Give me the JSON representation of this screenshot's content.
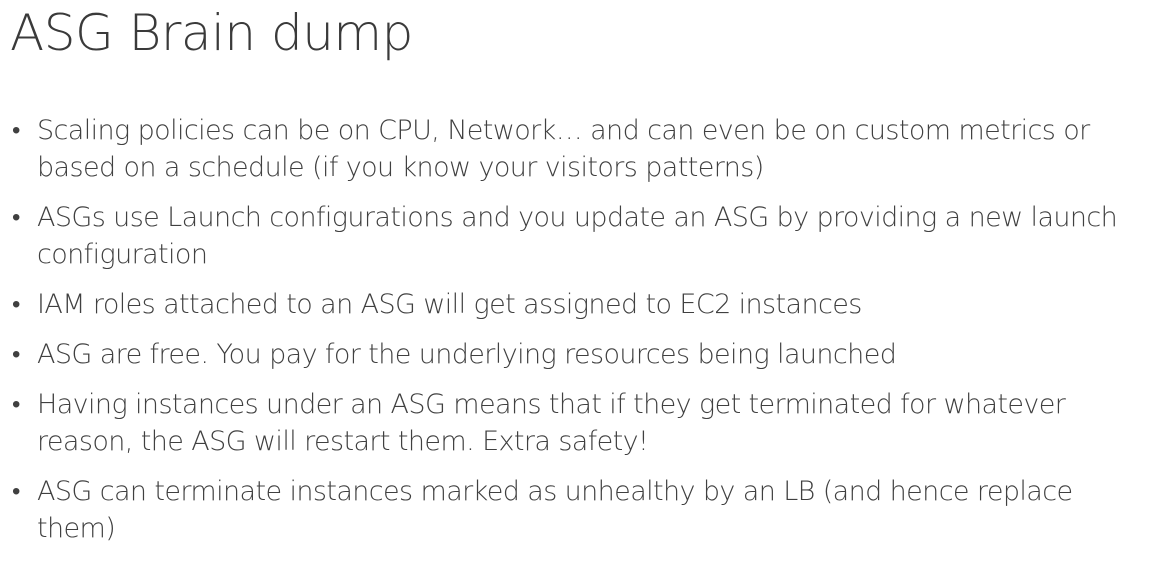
{
  "title": "ASG Brain dump",
  "bullets": [
    {
      "text": "Scaling policies can be on CPU, Network… and can even be on custom metrics or\nbased on a schedule (if you know your visitors patterns)"
    },
    {
      "text": "ASGs use Launch configurations and you update an ASG by providing a new launch\nconfiguration"
    },
    {
      "text": "IAM roles attached to an ASG will get assigned to EC2 instances"
    },
    {
      "text": "ASG are free. You pay for the underlying resources being launched"
    },
    {
      "text": "Having instances under an ASG means that if they get terminated for whatever\nreason, the ASG will restart them. Extra safety!"
    },
    {
      "text": "ASG can terminate instances marked as unhealthy by an LB (and hence replace\nthem)"
    }
  ],
  "bullet_symbol": "•"
}
